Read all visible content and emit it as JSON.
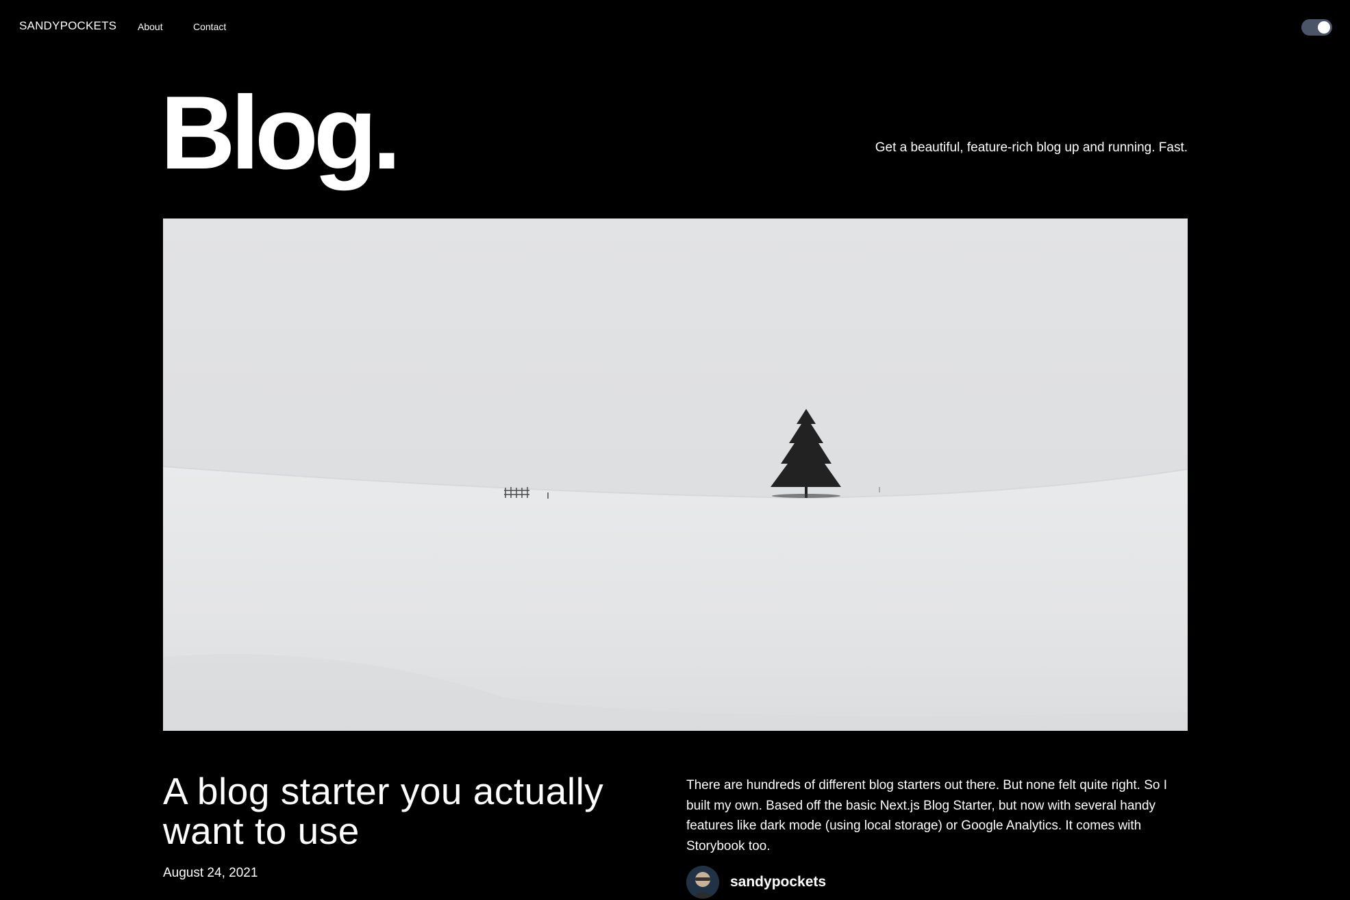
{
  "header": {
    "brand": "SANDYPOCKETS",
    "nav": [
      {
        "label": "About"
      },
      {
        "label": "Contact"
      }
    ],
    "theme_toggle": {
      "state": "dark"
    }
  },
  "hero": {
    "title": "Blog.",
    "tagline": "Get a beautiful, feature-rich blog up and running. Fast."
  },
  "featured_post": {
    "title": "A blog starter you actually want to use",
    "date": "August 24, 2021",
    "excerpt": "There are hundreds of different blog starters out there. But none felt quite right. So I built my own. Based off the basic Next.js Blog Starter, but now with several handy features like dark mode (using local storage) or Google Analytics. It comes with Storybook too.",
    "author": {
      "name": "sandypockets"
    }
  },
  "colors": {
    "background": "#000000",
    "text": "#ffffff",
    "toggle_track": "#4a5568"
  }
}
